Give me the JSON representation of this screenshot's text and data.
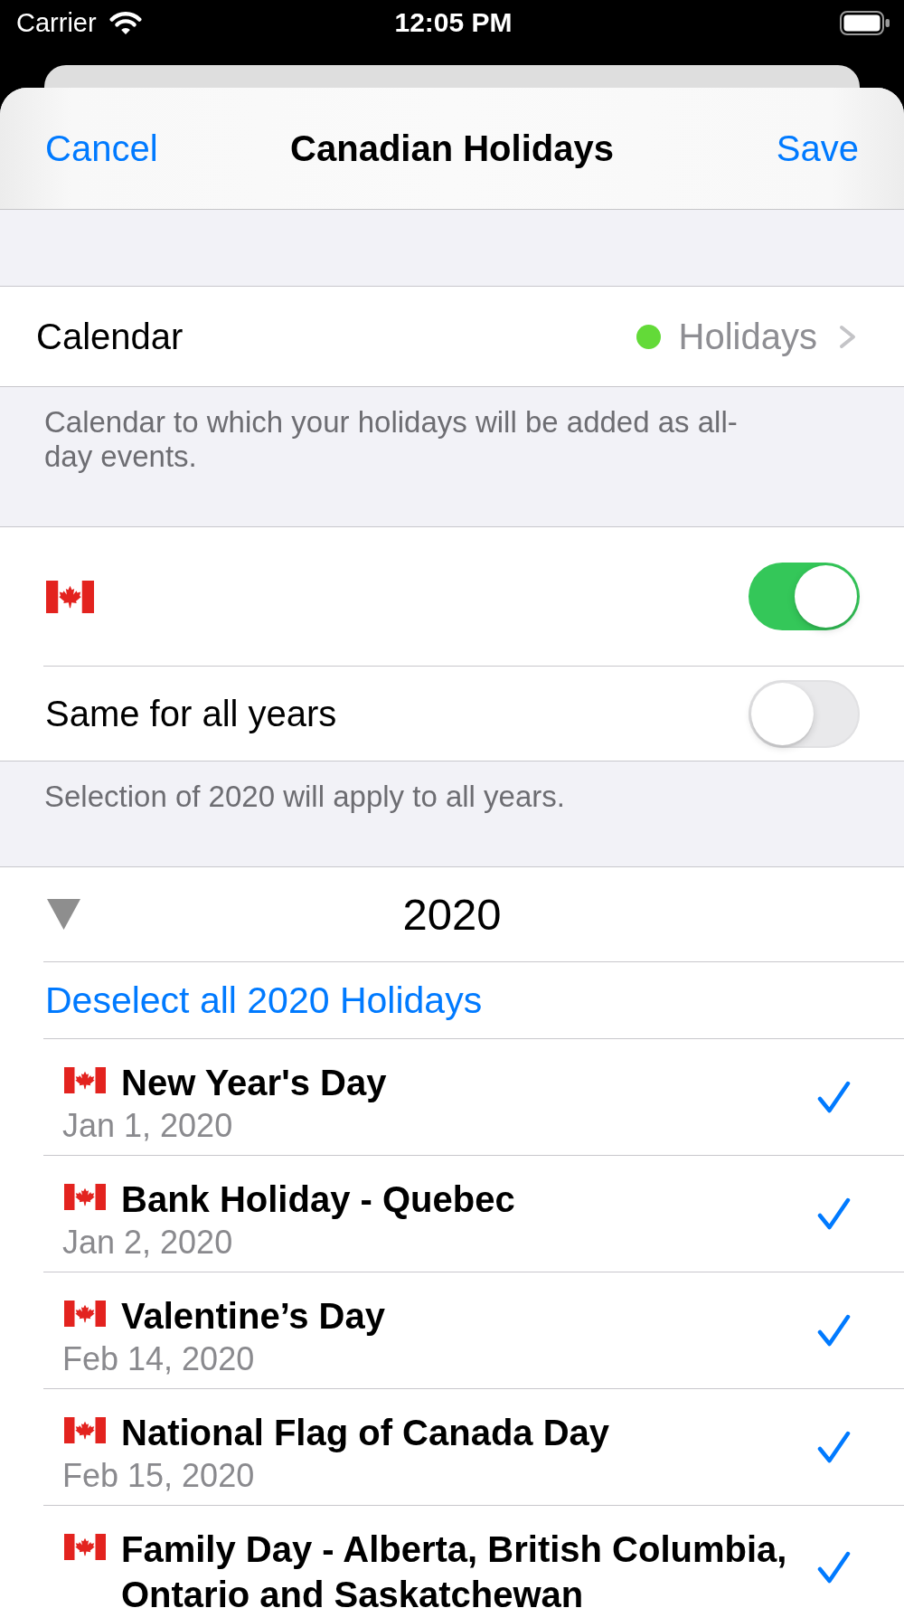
{
  "status_bar": {
    "carrier": "Carrier",
    "time": "12:05 PM"
  },
  "nav_bar": {
    "cancel": "Cancel",
    "title": "Canadian Holidays",
    "save": "Save"
  },
  "calendar": {
    "label": "Calendar",
    "value": "Holidays",
    "color": "#63da38",
    "footer": "Calendar to which your holidays will be added as all-day events."
  },
  "switches": [
    {
      "kind": "flag",
      "on": true
    },
    {
      "kind": "text",
      "label": "Same for all years",
      "on": false
    }
  ],
  "switches_footer": "Selection of 2020 will apply to all years.",
  "year_section": {
    "year": "2020",
    "expanded": true,
    "deselect_link": "Deselect all 2020 Holidays",
    "holidays": [
      {
        "title": "New Year's Day",
        "date": "Jan 1, 2020",
        "checked": true
      },
      {
        "title": "Bank Holiday - Quebec",
        "date": "Jan 2, 2020",
        "checked": true
      },
      {
        "title": "Valentine’s Day",
        "date": "Feb 14, 2020",
        "checked": true
      },
      {
        "title": "National Flag of Canada Day",
        "date": "Feb 15, 2020",
        "checked": true
      },
      {
        "title": "Family Day - Alberta, British Columbia, Ontario and Saskatchewan",
        "checked": true
      }
    ]
  }
}
